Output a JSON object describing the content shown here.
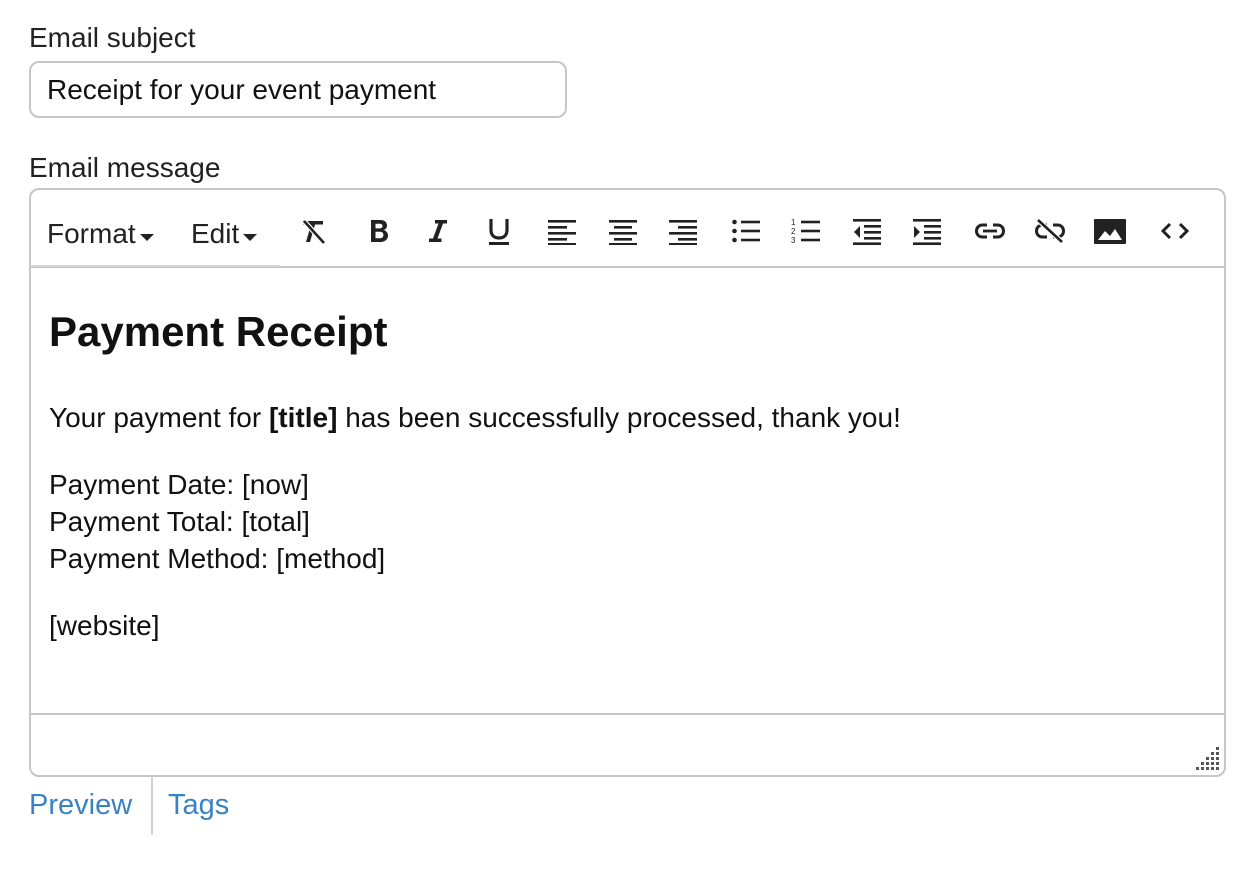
{
  "subject": {
    "label": "Email subject",
    "value": "Receipt for your event payment"
  },
  "message": {
    "label": "Email message",
    "menus": [
      "Format",
      "Edit"
    ],
    "toolbar_icons": [
      "clear-formatting-icon",
      "bold-icon",
      "italic-icon",
      "underline-icon",
      "align-left-icon",
      "align-center-icon",
      "align-right-icon",
      "bullet-list-icon",
      "numbered-list-icon",
      "outdent-icon",
      "indent-icon",
      "insert-link-icon",
      "remove-link-icon",
      "insert-image-icon",
      "source-code-icon"
    ],
    "body": {
      "heading": "Payment Receipt",
      "intro_before": "Your payment for ",
      "intro_bold": "[title]",
      "intro_after": " has been successfully processed, thank you!",
      "date_line": "Payment Date: [now]",
      "total_line": "Payment Total: [total]",
      "method_line": "Payment Method: [method]",
      "website_line": "[website]"
    }
  },
  "links": {
    "preview": "Preview",
    "tags": "Tags"
  },
  "colors": {
    "link": "#3a82c4",
    "border": "#c6c6c6",
    "text": "#111111"
  }
}
